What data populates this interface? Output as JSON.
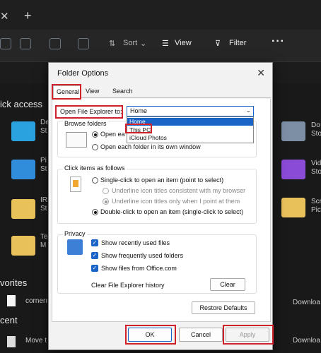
{
  "tab_bar": {
    "close": "✕",
    "new_tab": "+"
  },
  "toolbar": {
    "sort": "Sort",
    "view": "View",
    "filter": "Filter",
    "more": "···"
  },
  "sidebar": {
    "quick_access": "ick access",
    "favorites": "vorites",
    "recent": "cent"
  },
  "left_folders": [
    {
      "label": "De\nSt",
      "color": "#2aa2e0"
    },
    {
      "label": "Pi\nSt",
      "color": "#2f8ddb"
    },
    {
      "label": "IRS\nSt",
      "color": "#e9c15b"
    },
    {
      "label": "Te\nM",
      "color": "#e9c15b"
    }
  ],
  "right_folders": [
    {
      "label": "Do\nSto",
      "color": "#7d8fa5"
    },
    {
      "label": "Vid\nSto",
      "color": "#8a4bd6"
    },
    {
      "label": "Scr\nPict",
      "color": "#e9c15b"
    }
  ],
  "favorites_row": {
    "name": "cornerı",
    "location": "Downloa"
  },
  "recent_row": {
    "name": "Move t",
    "location": "Downloa"
  },
  "dialog": {
    "title": "Folder Options",
    "close": "✕",
    "tabs": [
      "General",
      "View",
      "Search"
    ],
    "open_label": "Open File Explorer to:",
    "open_value": "Home",
    "dropdown_options": [
      "Home",
      "This PC",
      "iCloud Photos"
    ],
    "browse": {
      "title": "Browse folders",
      "opt1": "Open ea",
      "opt2": "Open each folder in its own window"
    },
    "click": {
      "title": "Click items as follows",
      "single": "Single-click to open an item (point to select)",
      "underline1": "Underline icon titles consistent with my browser",
      "underline2": "Underline icon titles only when I point at them",
      "double": "Double-click to open an item (single-click to select)"
    },
    "privacy": {
      "title": "Privacy",
      "recent": "Show recently used files",
      "frequent": "Show frequently used folders",
      "office": "Show files from Office.com",
      "clear_label": "Clear File Explorer history",
      "clear_button": "Clear"
    },
    "restore": "Restore Defaults",
    "ok": "OK",
    "cancel": "Cancel",
    "apply": "Apply"
  },
  "colors": {
    "accent": "#1a64c8",
    "highlight": "#d0212b"
  }
}
